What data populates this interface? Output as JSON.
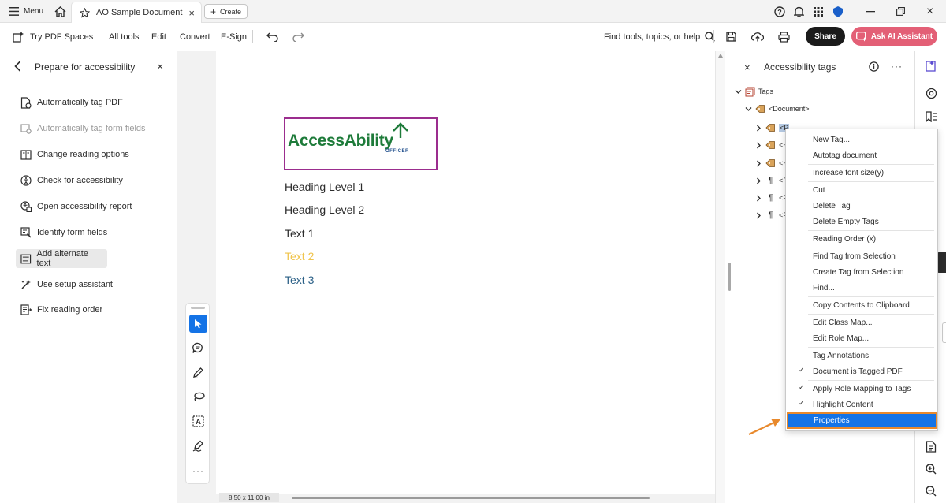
{
  "titlebar": {
    "menu_label": "Menu",
    "tab_title": "AO Sample Document",
    "create_label": "Create"
  },
  "toolbar": {
    "spaces_label": "Try PDF Spaces",
    "all_tools": "All tools",
    "edit": "Edit",
    "convert": "Convert",
    "esign": "E-Sign",
    "search_label": "Find tools, topics, or help",
    "share_label": "Share",
    "ai_label": "Ask AI Assistant"
  },
  "left_panel": {
    "title": "Prepare for accessibility",
    "items": [
      {
        "label": "Automatically tag PDF"
      },
      {
        "label": "Automatically tag form fields"
      },
      {
        "label": "Change reading options"
      },
      {
        "label": "Check for accessibility"
      },
      {
        "label": "Open accessibility report"
      },
      {
        "label": "Identify form fields"
      },
      {
        "label": "Add alternate text"
      },
      {
        "label": "Use setup assistant"
      },
      {
        "label": "Fix reading order"
      }
    ]
  },
  "document": {
    "logo_main": "AccessAbility",
    "logo_sub": "OFFICER",
    "lines": [
      {
        "text": "Heading Level 1"
      },
      {
        "text": "Heading Level 2"
      },
      {
        "text": "Text 1"
      },
      {
        "text": "Text 2"
      },
      {
        "text": "Text 3"
      }
    ],
    "page_size": "8.50 x 11.00 in"
  },
  "right_panel": {
    "title": "Accessibility tags",
    "tree_root": "Tags",
    "tree_document": "<Document>",
    "tree_child_first": "<P",
    "tree_child_h": "<H",
    "tree_child_p": "<P"
  },
  "context_menu": {
    "items": [
      {
        "label": "New Tag...",
        "checked": false
      },
      {
        "label": "Autotag document",
        "checked": false
      },
      {
        "label": "Increase font size(y)",
        "checked": false
      },
      {
        "label": "Cut",
        "checked": false
      },
      {
        "label": "Delete Tag",
        "checked": false
      },
      {
        "label": "Delete Empty Tags",
        "checked": false
      },
      {
        "label": "Reading Order (x)",
        "checked": false
      },
      {
        "label": "Find Tag from Selection",
        "checked": false
      },
      {
        "label": "Create Tag from Selection",
        "checked": false
      },
      {
        "label": "Find...",
        "checked": false
      },
      {
        "label": "Copy Contents to Clipboard",
        "checked": false
      },
      {
        "label": "Edit Class Map...",
        "checked": false
      },
      {
        "label": "Edit Role Map...",
        "checked": false
      },
      {
        "label": "Tag Annotations",
        "checked": false
      },
      {
        "label": "Document is Tagged PDF",
        "checked": true
      },
      {
        "label": "Apply Role Mapping to Tags",
        "checked": true
      },
      {
        "label": "Highlight Content",
        "checked": true
      },
      {
        "label": "Properties",
        "checked": false
      }
    ],
    "check_mark": "✓"
  },
  "colors": {
    "accent_blue": "#1473e6",
    "ai_button": "#e35f76",
    "highlight_orange": "#e8892c",
    "logo_border": "#9b2d8e",
    "logo_green": "#1e7b3a",
    "logo_blue": "#1f4e8c",
    "text3_color": "#2a5f86",
    "text2_color": "#f0c44c"
  }
}
